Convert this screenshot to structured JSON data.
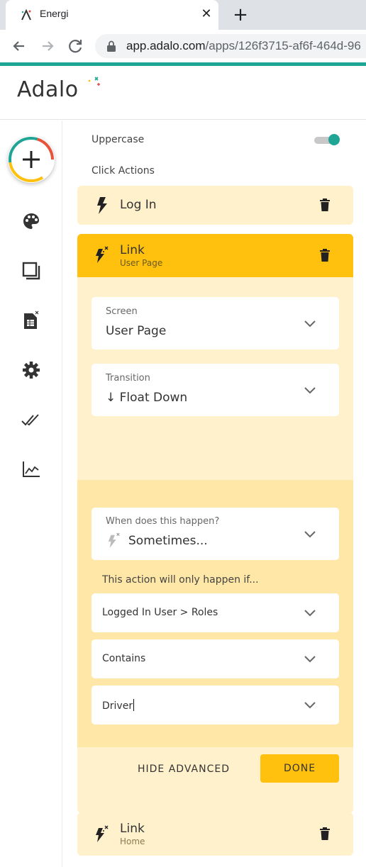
{
  "browser": {
    "tab_title": "Energi",
    "tab_close": "✕",
    "new_tab": "+",
    "url_domain": "app.adalo.com",
    "url_path": "/apps/126f3715-af6f-464d-96"
  },
  "app": {
    "logo_text": "Adalo",
    "accent_color": "#1fa594",
    "highlight_color": "#ffc00e"
  },
  "rail": {
    "add_button_icon": "plus-icon",
    "icons": [
      "palette-icon",
      "screens-icon",
      "database-icon",
      "settings-icon",
      "publish-check-icon",
      "analytics-icon"
    ]
  },
  "panel": {
    "uppercase_label": "Uppercase",
    "uppercase_enabled": true,
    "click_actions_label": "Click Actions",
    "actions": [
      {
        "title": "Log In",
        "subtitle": ""
      },
      {
        "title": "Link",
        "subtitle": "User Page"
      },
      {
        "title": "Link",
        "subtitle": "Home"
      }
    ],
    "screen_field": {
      "label": "Screen",
      "value": "User Page"
    },
    "transition_field": {
      "label": "Transition",
      "value": "↓ Float Down"
    },
    "when_field": {
      "label": "When does this happen?",
      "value": "Sometimes..."
    },
    "only_if_text": "This action will only happen if...",
    "condition_1": "Logged In User > Roles",
    "condition_2": "Contains",
    "condition_3": "Driver",
    "hide_advanced": "HIDE ADVANCED",
    "done": "DONE"
  }
}
